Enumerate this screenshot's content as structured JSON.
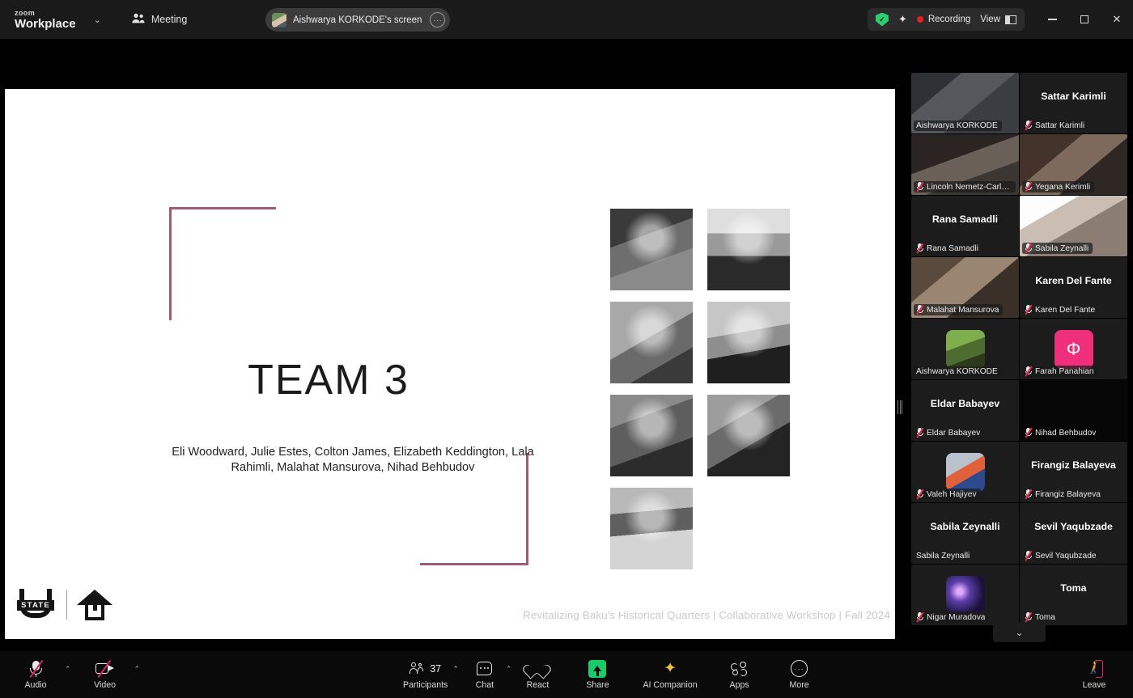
{
  "titlebar": {
    "brand_line1": "zoom",
    "brand_line2": "Workplace",
    "brand_caret": "⌄",
    "meeting_label": "Meeting",
    "share_pill_label": "Aishwarya KORKODE's screen",
    "share_pill_more": "···",
    "shield_label": "✓",
    "sparkle_label": "✦",
    "recording_label": "Recording",
    "view_label": "View",
    "minimize_label": "",
    "maximize_label": "",
    "close_label": "✕",
    "accent_green": "#2ecc71",
    "recording_red": "#e02424"
  },
  "slide": {
    "title": "TEAM 3",
    "names": "Eli Woodward, Julie Estes, Colton James, Elizabeth Keddington, Lala Rahimli, Malahat Mansurova, Nihad Behbudov",
    "footer": "Revitalizing Baku's Historical Quarters | Collaborative Workshop | Fall 2024",
    "accent_color": "#9e5c72",
    "logo_usu_text": "STATE",
    "photo_count": 7
  },
  "participants": [
    {
      "name": "Aishwarya KORKODE",
      "video": true,
      "muted": false,
      "name_only": false,
      "active": false
    },
    {
      "name": "Sattar Karimli",
      "video": false,
      "muted": true,
      "name_only": true,
      "active": false
    },
    {
      "name": "Lincoln Nemetz-Carls...",
      "video": true,
      "muted": true,
      "name_only": false,
      "active": false
    },
    {
      "name": "Yegana Kerimli",
      "video": true,
      "muted": true,
      "name_only": false,
      "active": false
    },
    {
      "name": "Rana Samadli",
      "video": false,
      "muted": true,
      "name_only": true,
      "active": false
    },
    {
      "name": "Sabila Zeynalli",
      "video": true,
      "muted": true,
      "name_only": false,
      "active": true
    },
    {
      "name": "Malahat Mansurova",
      "video": true,
      "muted": true,
      "name_only": false,
      "active": false
    },
    {
      "name": "Karen Del Fante",
      "video": false,
      "muted": true,
      "name_only": true,
      "active": false
    },
    {
      "name": "Aishwarya KORKODE",
      "video": false,
      "muted": false,
      "name_only": false,
      "active": false
    },
    {
      "name": "Farah Panahian",
      "video": false,
      "muted": true,
      "name_only": false,
      "active": false
    },
    {
      "name": "Eldar Babayev",
      "video": false,
      "muted": true,
      "name_only": true,
      "active": false
    },
    {
      "name": "Nihad Behbudov",
      "video": false,
      "muted": true,
      "name_only": false,
      "active": false
    },
    {
      "name": "Valeh Hajiyev",
      "video": false,
      "muted": true,
      "name_only": false,
      "active": false
    },
    {
      "name": "Firangiz Balayeva",
      "video": false,
      "muted": true,
      "name_only": true,
      "active": false
    },
    {
      "name": "Sabila Zeynalli",
      "video": false,
      "muted": false,
      "name_only": true,
      "active": false
    },
    {
      "name": "Sevil Yaqubzade",
      "video": false,
      "muted": true,
      "name_only": true,
      "active": false
    },
    {
      "name": "Nigar Muradova",
      "video": false,
      "muted": true,
      "name_only": false,
      "active": false
    },
    {
      "name": "Toma",
      "video": false,
      "muted": true,
      "name_only": true,
      "active": false
    }
  ],
  "panel": {
    "scroll_more_label": "⌄"
  },
  "toolbar": {
    "audio_label": "Audio",
    "video_label": "Video",
    "participants_label": "Participants",
    "participants_count": "37",
    "chat_label": "Chat",
    "react_label": "React",
    "share_label": "Share",
    "ai_label": "AI Companion",
    "ai_icon": "✦",
    "apps_label": "Apps",
    "more_label": "More",
    "more_icon": "···",
    "leave_label": "Leave",
    "leave_icon": "🚶",
    "caret": "⌃",
    "share_green": "#19cb6a",
    "leave_red": "#e8205a",
    "ai_gold": "#f0c040"
  }
}
